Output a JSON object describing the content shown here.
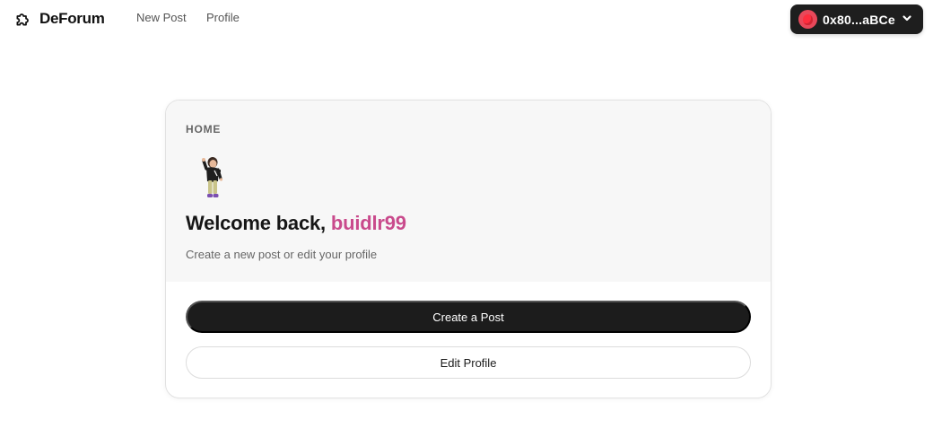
{
  "header": {
    "brand_name": "DeForum",
    "brand_icon": "puzzle-icon",
    "nav": [
      {
        "label": "New Post"
      },
      {
        "label": "Profile"
      }
    ],
    "wallet": {
      "address": "0x80...aBCe",
      "avatar_icon": "balloon-icon",
      "chevron_icon": "chevron-down-icon"
    }
  },
  "card": {
    "kicker": "HOME",
    "welcome_prefix": "Welcome back, ",
    "username": "buidlr99",
    "subtitle": "Create a new post or edit your profile",
    "primary_button": "Create a Post",
    "secondary_button": "Edit Profile"
  },
  "colors": {
    "accent_username": "#c94a8c",
    "primary_button_bg": "#1c1c1c",
    "wallet_bg": "#1e1e1e",
    "wallet_avatar": "#e8485a"
  }
}
